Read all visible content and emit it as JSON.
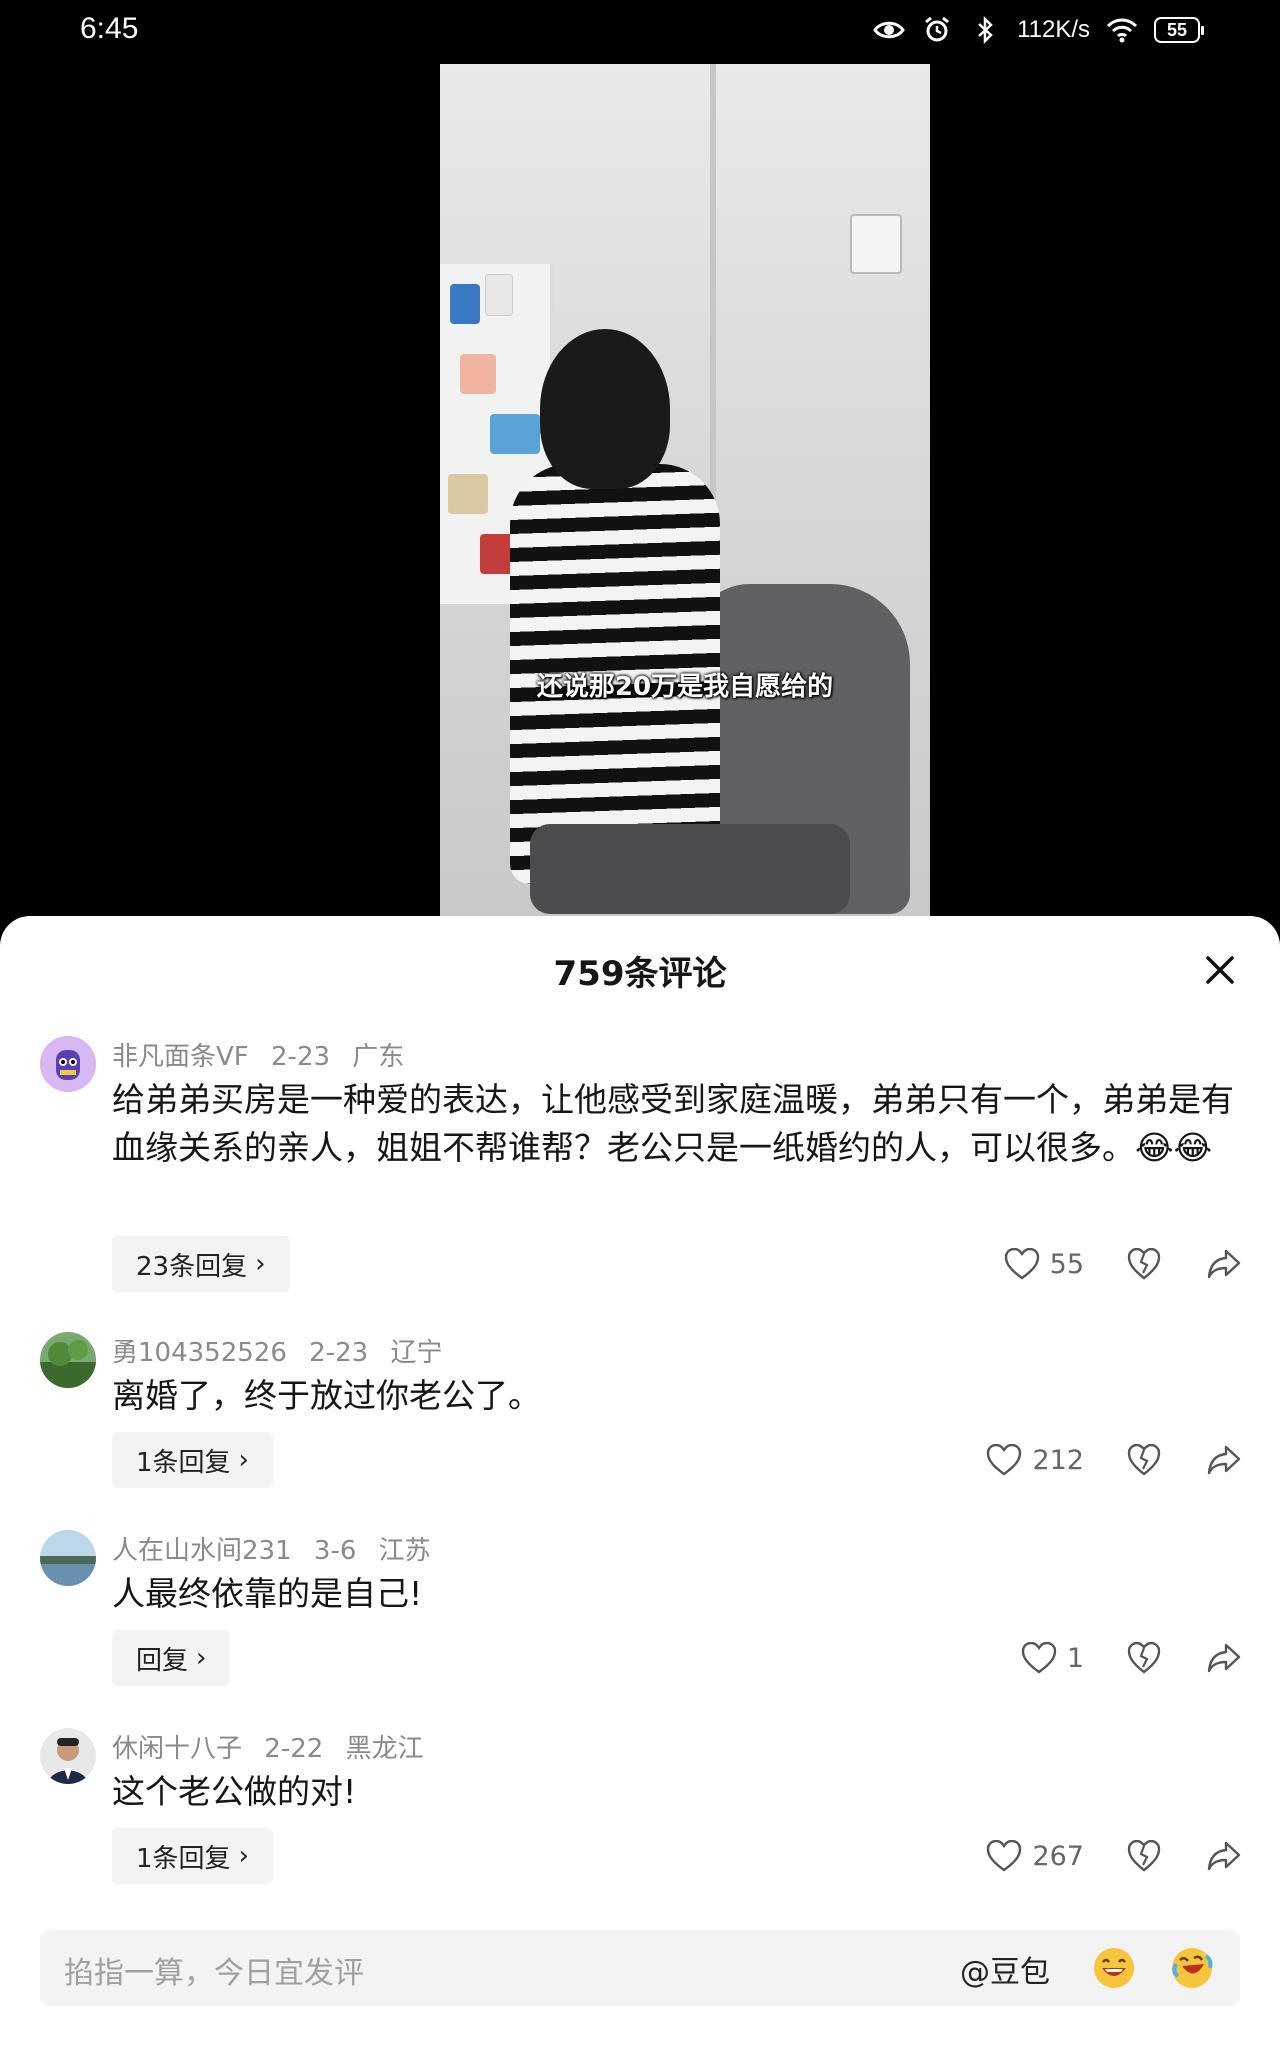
{
  "status": {
    "time": "6:45",
    "speed": "112K/s",
    "battery": "55",
    "icons": [
      "eye-icon",
      "alarm-icon",
      "bluetooth-icon",
      "wifi-icon",
      "battery-icon"
    ]
  },
  "video": {
    "caption": "还说那20万是我自愿给的"
  },
  "comments_panel": {
    "title": "759条评论",
    "comments": [
      {
        "user": "非凡面条VF",
        "date": "2-23",
        "location": "广东",
        "text": "给弟弟买房是一种爱的表达，让他感受到家庭温暖，弟弟只有一个，弟弟是有血缘关系的亲人，姐姐不帮谁帮？老公只是一纸婚约的人，可以很多。",
        "emoji": "😂😂",
        "replies": "23条回复",
        "likes": "55"
      },
      {
        "user": "勇104352526",
        "date": "2-23",
        "location": "辽宁",
        "text": "离婚了，终于放过你老公了。",
        "replies": "1条回复",
        "likes": "212"
      },
      {
        "user": "人在山水间231",
        "date": "3-6",
        "location": "江苏",
        "text": "人最终依靠的是自己!",
        "replies": "回复",
        "likes": "1"
      },
      {
        "user": "休闲十八子",
        "date": "2-22",
        "location": "黑龙江",
        "text": "这个老公做的对!",
        "replies": "1条回复",
        "likes": "267"
      }
    ]
  },
  "input": {
    "placeholder": "掐指一算，今日宜发评",
    "at_label": "@豆包"
  }
}
